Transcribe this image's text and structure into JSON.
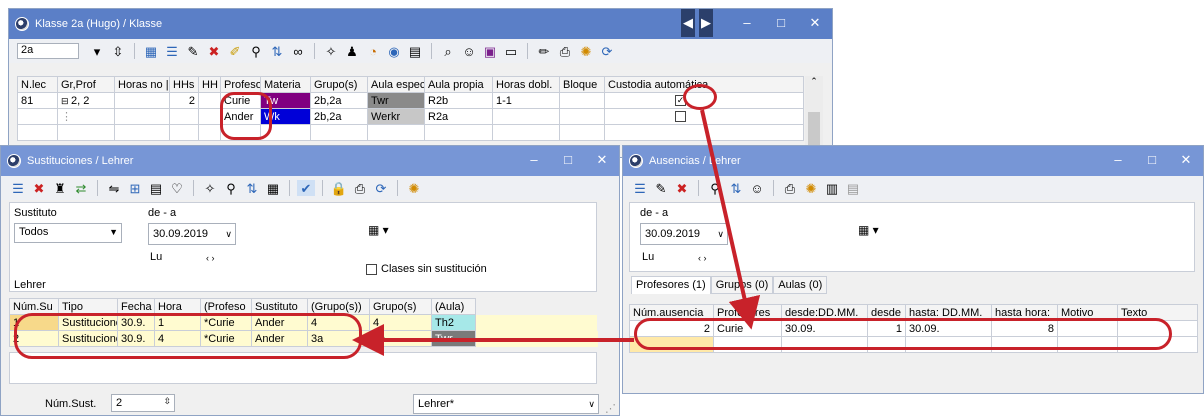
{
  "klasse": {
    "title": "Klasse 2a (Hugo) / Klasse",
    "selector_value": "2a",
    "columns": [
      "N.lec",
      "Gr,Prof",
      "Horas no |",
      "HHs",
      "HH",
      "Profesor",
      "Materia",
      "Grupo(s)",
      "Aula espec",
      "Aula propia",
      "Horas dobl.",
      "Bloque",
      "Custodia automática"
    ],
    "rows": [
      {
        "nlec": "81",
        "gr": "2, 2",
        "hh": "2",
        "prof": "Curie",
        "materia": "Tw",
        "grupos": "2b,2a",
        "aula_esp": "Twr",
        "aula_prop": "R2b",
        "horas_dobl": "1-1"
      },
      {
        "prof": "Ander",
        "materia": "Wk",
        "grupos": "2b,2a",
        "aula_esp": "Werkr",
        "aula_prop": "R2a"
      }
    ]
  },
  "sustituciones": {
    "title": "Sustituciones / Lehrer",
    "sustituto_label": "Sustituto",
    "sustituto_value": "Todos",
    "date_label": "de - a",
    "date_value": "30.09.2019",
    "day_label": "Lu",
    "nav": "‹ ›",
    "sin_sust_label": "Clases sin sustitución",
    "lehrer_label": "Lehrer",
    "columns": [
      "Núm.Su",
      "Tipo",
      "Fecha",
      "Hora",
      "(Profeso",
      "Sustituto",
      "(Grupo(s))",
      "Grupo(s)",
      "(Aula)"
    ],
    "rows": [
      {
        "num": "1",
        "tipo": "Sustituciones",
        "fecha": "30.9.",
        "hora": "1",
        "prof": "*Curie",
        "sust": "Ander",
        "grupo_old": "4",
        "grupo": "4",
        "aula": "Th2"
      },
      {
        "num": "2",
        "tipo": "Sustituciones",
        "fecha": "30.9.",
        "hora": "4",
        "prof": "*Curie",
        "sust": "Ander",
        "grupo_old": "3a",
        "grupo": "3a",
        "aula": "Twr"
      }
    ],
    "footer_label": "Núm.Sust.",
    "footer_value": "2",
    "footer_select": "Lehrer*"
  },
  "ausencias": {
    "title": "Ausencias / Lehrer",
    "date_label": "de - a",
    "date_value": "30.09.2019",
    "day_label": "Lu",
    "nav": "‹ ›",
    "tabs": [
      "Profesores (1)",
      "Grupos (0)",
      "Aulas (0)"
    ],
    "columns": [
      "Núm.ausencia",
      "Profesores",
      "desde:DD.MM.",
      "desde",
      "hasta: DD.MM.",
      "hasta hora:",
      "Motivo",
      "Texto"
    ],
    "rows": [
      {
        "num": "2",
        "prof": "Curie",
        "desde_dm": "30.09.",
        "desde": "1",
        "hasta_dm": "30.09.",
        "hasta_hora": "8"
      }
    ]
  },
  "colors": {
    "accent": "#c8222a",
    "title_bar": "#5b7fc7",
    "tw": "#800080",
    "wk": "#0000d8"
  }
}
